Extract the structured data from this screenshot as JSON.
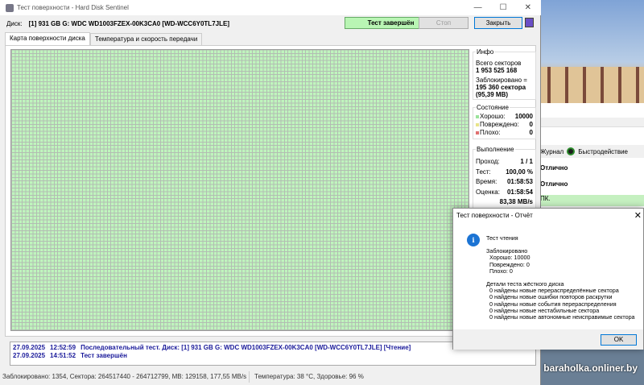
{
  "window": {
    "title": "Тест поверхности - Hard Disk Sentinel",
    "minimize": "—",
    "maximize": "☐",
    "close": "✕"
  },
  "toolbar": {
    "disk_label": "Диск:",
    "disk_value": "[1] 931 GB G: WDC WD1003FZEX-00K3CA0 [WD-WCC6Y0TL7JLE]",
    "status": "Тест завершён",
    "stop": "Стоп",
    "close": "Закрыть"
  },
  "tabs": [
    "Карта поверхности диска",
    "Температура и скорость передачи"
  ],
  "info": {
    "title": "Инфо",
    "total_label": "Всего секторов",
    "total_value": "1 953 525 168",
    "blocked_label": "Заблокировано =",
    "blocked_value": "195 360 сектора",
    "blocked_mb": "(95,39 MB)"
  },
  "state": {
    "title": "Состояние",
    "good_label": "Хорошо:",
    "good": "10000",
    "damaged_label": "Повреждено:",
    "damaged": "0",
    "bad_label": "Плохо:",
    "bad": "0",
    "colors": {
      "good": "#9be39b",
      "damaged": "#e8e48a",
      "bad": "#e07070"
    }
  },
  "progress": {
    "title": "Выполнение",
    "pass_label": "Проход:",
    "pass": "1 / 1",
    "test_label": "Тест:",
    "test": "100,00 %",
    "time_label": "Время:",
    "time": "01:58:53",
    "est_label": "Оценка:",
    "est": "01:58:54",
    "speed": "83,38 MB/s"
  },
  "log": [
    {
      "date": "27.09.2025",
      "time": "12:52:59",
      "msg": "Последовательный тест. Диск: [1] 931 GB G: WDC WD1003FZEX-00K3CA0 [WD-WCC6Y0TL7JLE] [Чтение]"
    },
    {
      "date": "27.09.2025",
      "time": "14:51:52",
      "msg": "Тест завершён"
    }
  ],
  "statusbar": {
    "left": "Заблокировано: 1354, Сектора: 264517440 - 264712799, MB: 129158, 177,55 MB/s",
    "right": "Температура: 38  °C,  Здоровье: 96 %"
  },
  "background_app": {
    "tab_journal": "Журнал",
    "tab_perf": "Быстродействие",
    "v1": "Отлично",
    "v2": "Отлично",
    "pk": "ПК."
  },
  "dialog": {
    "title": "Тест поверхности - Отчёт",
    "close": "✕",
    "icon": "i",
    "lines": [
      "Тест чтения",
      "",
      "Заблокировано",
      "  Хорошо: 10000",
      "  Повреждено: 0",
      "  Плохо: 0",
      "",
      "Детали теста жёсткого диска",
      "  0 найдены новые перераспределённые сектора",
      "  0 найдены новые ошибки повторов раскрутки",
      "  0 найдены новые события перераспределения",
      "  0 найдены новые нестабильные сектора",
      "  0 найдены новые автономные неисправимые сектора"
    ],
    "ok": "OK"
  },
  "watermark": "baraholka.onliner.by"
}
